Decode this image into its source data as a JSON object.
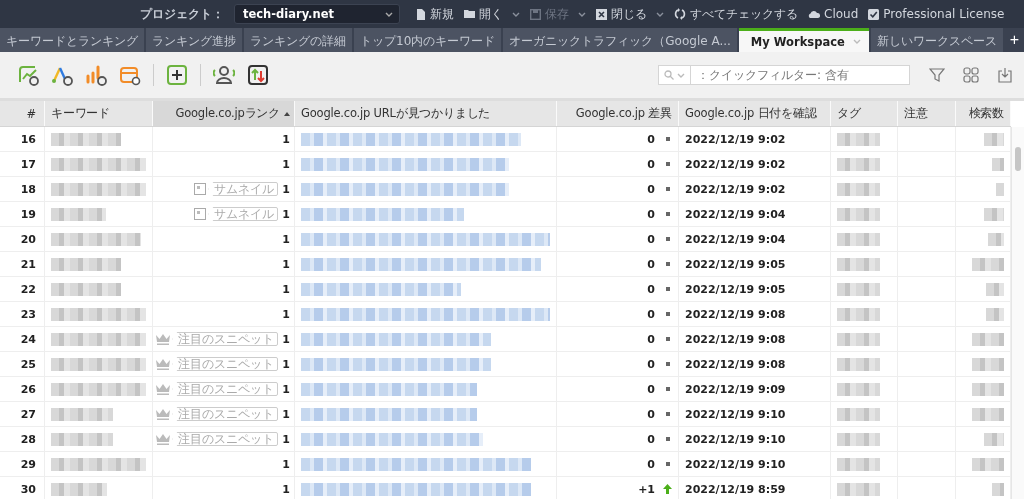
{
  "project": {
    "label": "プロジェクト：",
    "value": "tech-diary.net"
  },
  "menu": [
    {
      "kind": "file",
      "label": "新規",
      "dropdown": false,
      "disabled": false
    },
    {
      "kind": "folder",
      "label": "開く",
      "dropdown": true,
      "disabled": false
    },
    {
      "kind": "save",
      "label": "保存",
      "dropdown": true,
      "disabled": true
    },
    {
      "kind": "close",
      "label": "閉じる",
      "dropdown": true,
      "disabled": false
    },
    {
      "kind": "sync",
      "label": "すべてチェックする",
      "dropdown": false,
      "disabled": false
    },
    {
      "kind": "cloud",
      "label": "Cloud",
      "dropdown": false,
      "disabled": false
    },
    {
      "kind": "check",
      "label": "Professional License",
      "dropdown": false,
      "disabled": false
    }
  ],
  "tabs": [
    {
      "label": "キーワードとランキング",
      "selected": false
    },
    {
      "label": "ランキング進捗",
      "selected": false
    },
    {
      "label": "ランキングの詳細",
      "selected": false
    },
    {
      "label": "トップ10内のキーワード",
      "selected": false
    },
    {
      "label": "オーガニックトラフィック（Google A...",
      "selected": false
    },
    {
      "label": "My Workspace",
      "selected": true
    },
    {
      "label": "新しいワークスペース",
      "selected": false
    }
  ],
  "add_tab": "+",
  "filter": {
    "placeholder": "：クイックフィルター: 含有"
  },
  "table": {
    "columns": [
      "#",
      "キーワード",
      "Google.co.jpランク",
      "Google.co.jp URLが見つかりました",
      "Google.co.jp 差異",
      "Google.co.jp 日付を確認",
      "タグ",
      "注意",
      "検索数"
    ],
    "rows": [
      {
        "num": "16",
        "rank": "1",
        "diff": {
          "value": "0",
          "kind": "same"
        },
        "date": "2022/12/19 9:02"
      },
      {
        "num": "17",
        "rank": "1",
        "diff": {
          "value": "0",
          "kind": "same"
        },
        "date": "2022/12/19 9:02"
      },
      {
        "num": "18",
        "snippet": {
          "kind": "thumbnail",
          "label": "サムネイル"
        },
        "rank": "1",
        "diff": {
          "value": "0",
          "kind": "same"
        },
        "date": "2022/12/19 9:02"
      },
      {
        "num": "19",
        "snippet": {
          "kind": "thumbnail",
          "label": "サムネイル"
        },
        "rank": "1",
        "diff": {
          "value": "0",
          "kind": "same"
        },
        "date": "2022/12/19 9:04"
      },
      {
        "num": "20",
        "rank": "1",
        "diff": {
          "value": "0",
          "kind": "same"
        },
        "date": "2022/12/19 9:04"
      },
      {
        "num": "21",
        "rank": "1",
        "diff": {
          "value": "0",
          "kind": "same"
        },
        "date": "2022/12/19 9:05"
      },
      {
        "num": "22",
        "rank": "1",
        "diff": {
          "value": "0",
          "kind": "same"
        },
        "date": "2022/12/19 9:05"
      },
      {
        "num": "23",
        "rank": "1",
        "diff": {
          "value": "0",
          "kind": "same"
        },
        "date": "2022/12/19 9:08"
      },
      {
        "num": "24",
        "snippet": {
          "kind": "featured",
          "label": "注目のスニペット"
        },
        "rank": "1",
        "diff": {
          "value": "0",
          "kind": "same"
        },
        "date": "2022/12/19 9:08"
      },
      {
        "num": "25",
        "snippet": {
          "kind": "featured",
          "label": "注目のスニペット"
        },
        "rank": "1",
        "diff": {
          "value": "0",
          "kind": "same"
        },
        "date": "2022/12/19 9:08"
      },
      {
        "num": "26",
        "snippet": {
          "kind": "featured",
          "label": "注目のスニペット"
        },
        "rank": "1",
        "diff": {
          "value": "0",
          "kind": "same"
        },
        "date": "2022/12/19 9:09"
      },
      {
        "num": "27",
        "snippet": {
          "kind": "featured",
          "label": "注目のスニペット"
        },
        "rank": "1",
        "diff": {
          "value": "0",
          "kind": "same"
        },
        "date": "2022/12/19 9:10"
      },
      {
        "num": "28",
        "snippet": {
          "kind": "featured",
          "label": "注目のスニペット"
        },
        "rank": "1",
        "diff": {
          "value": "0",
          "kind": "same"
        },
        "date": "2022/12/19 9:10"
      },
      {
        "num": "29",
        "rank": "1",
        "diff": {
          "value": "0",
          "kind": "same"
        },
        "date": "2022/12/19 9:10"
      },
      {
        "num": "30",
        "rank": "1",
        "diff": {
          "value": "+1",
          "kind": "up"
        },
        "date": "2022/12/19 8:59"
      }
    ]
  }
}
